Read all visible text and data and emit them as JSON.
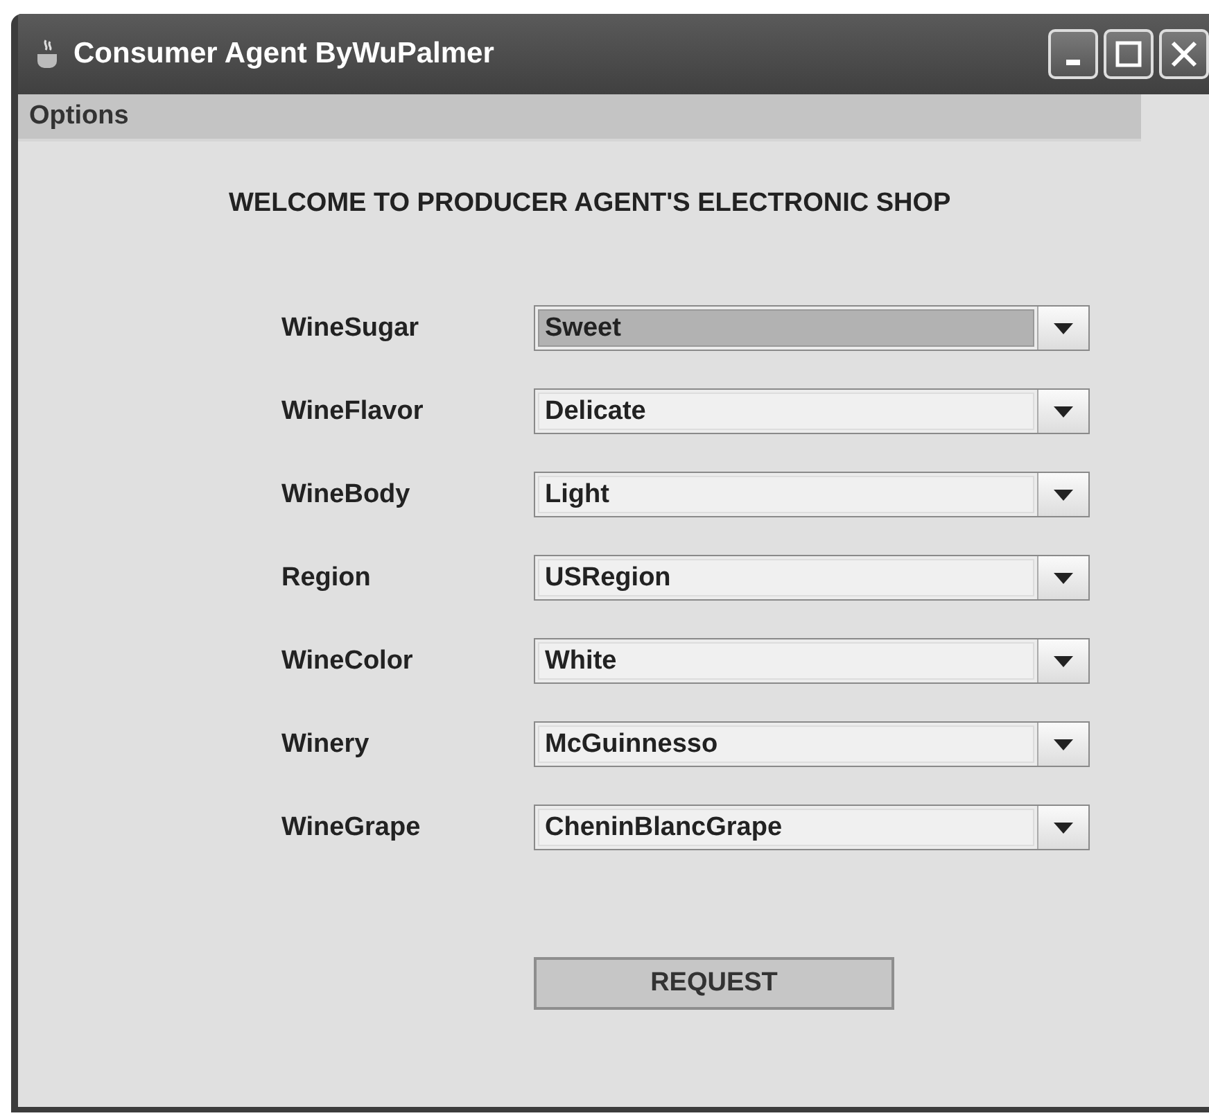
{
  "window": {
    "title": "Consumer Agent ByWuPalmer"
  },
  "menu": [
    "Options"
  ],
  "heading": "WELCOME TO PRODUCER AGENT'S ELECTRONIC SHOP",
  "fields": [
    {
      "label": "WineSugar",
      "value": "Sweet",
      "focused": true
    },
    {
      "label": "WineFlavor",
      "value": "Delicate",
      "focused": false
    },
    {
      "label": "WineBody",
      "value": "Light",
      "focused": false
    },
    {
      "label": "Region",
      "value": "USRegion",
      "focused": false
    },
    {
      "label": "WineColor",
      "value": "White",
      "focused": false
    },
    {
      "label": "Winery",
      "value": "McGuinnesso",
      "focused": false
    },
    {
      "label": "WineGrape",
      "value": "CheninBlancGrape",
      "focused": false
    }
  ],
  "button": "REQUEST"
}
